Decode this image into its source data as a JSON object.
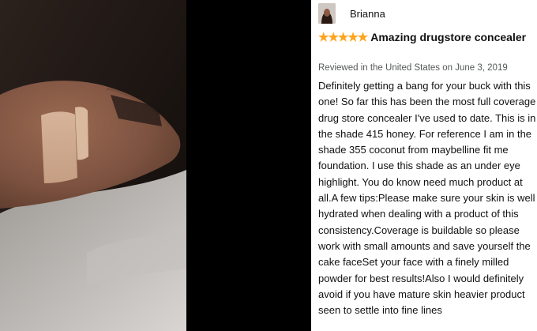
{
  "reviewer": {
    "name": "Brianna"
  },
  "review": {
    "rating": 5,
    "stars": "★★★★★",
    "title": "Amazing drugstore concealer",
    "meta": "Reviewed in the United States on June 3, 2019",
    "body": "Definitely getting a bang for your buck with this one! So far this has been the most full coverage drug store concealer I've used to date. This is in the shade 415 honey. For reference I am in the shade 355 coconut from maybelline fit me foundation. I use this shade as an under eye highlight. You do know need much product at all.A few tips:Please make sure your skin is well hydrated when dealing with a product of this consistency.Coverage is buildable so please work with small amounts and save yourself the cake faceSet your face with a finely milled powder for best results!Also I would definitely avoid if you have mature skin heavier product seen to settle into fine lines"
  },
  "colors": {
    "star": "#ffa41c",
    "meta": "#565959"
  }
}
